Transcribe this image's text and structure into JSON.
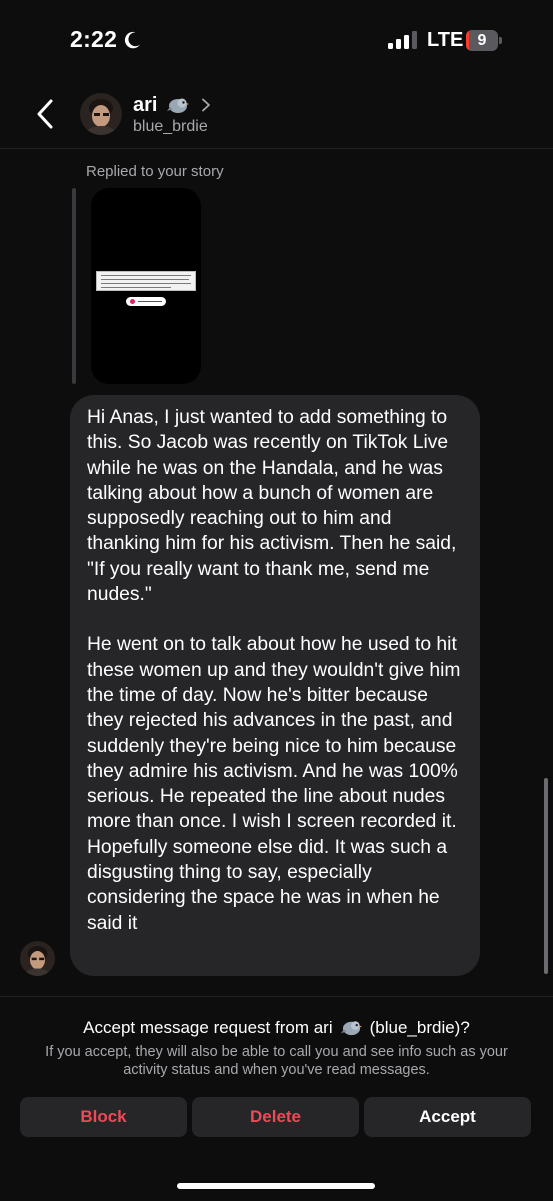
{
  "status_bar": {
    "time": "2:22",
    "carrier": "LTE",
    "battery_level": "9",
    "battery_fraction": 0.09
  },
  "header": {
    "name": "ari",
    "username": "blue_brdie",
    "name_icon": "bird-icon",
    "back_icon": "chevron-left-icon",
    "profile_icon": "chevron-right-icon"
  },
  "conversation": {
    "replied_label": "Replied to your story",
    "message_paragraphs": [
      "Hi Anas, I just wanted to add something to this. So Jacob was recently on TikTok Live while he was on the Handala, and he was talking about how a bunch of women are supposedly reaching out to him and thanking him for his activism. Then he said, \"If you really want to thank me, send me nudes.\"",
      "He went on to talk about how he used to hit these women up and they wouldn't give him the time of day. Now he's bitter because they rejected his advances in the past, and suddenly they're being nice to him because they admire his activism. And he was 100% serious. He repeated the line about nudes more than once. I wish I screen recorded it. Hopefully someone else did. It was such a disgusting thing to say, especially considering the space he was in when he said it"
    ]
  },
  "request": {
    "title_prefix": "Accept message request from ari",
    "title_suffix": "(blue_brdie)?",
    "description": "If you accept, they will also be able to call you and see info such as your activity status and when you've read messages.",
    "block_label": "Block",
    "delete_label": "Delete",
    "accept_label": "Accept"
  },
  "colors": {
    "background": "#0d0d0e",
    "bubble": "#262629",
    "danger": "#ed4956",
    "muted_text": "#a8a8ad"
  }
}
